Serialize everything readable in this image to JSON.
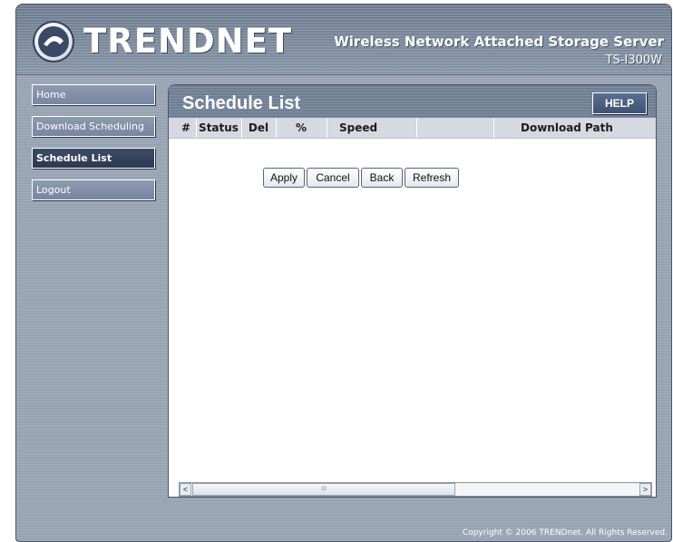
{
  "header": {
    "brand": "TRENDNET",
    "product_title": "Wireless Network Attached Storage Server",
    "model": "TS-I300W"
  },
  "sidebar": {
    "items": [
      {
        "label": "Home"
      },
      {
        "label": "Download Scheduling"
      },
      {
        "label": "Schedule List",
        "active": true
      },
      {
        "label": "Logout"
      }
    ]
  },
  "main": {
    "title": "Schedule List",
    "help_label": "HELP",
    "columns": [
      "#",
      "Status",
      "Del",
      "%",
      "Speed",
      "",
      "Download Path"
    ],
    "rows": [],
    "buttons": {
      "apply": "Apply",
      "cancel": "Cancel",
      "back": "Back",
      "refresh": "Refresh"
    },
    "scrollbar": {
      "left_arrow": "<",
      "right_arrow": ">",
      "thumb_grip": "III"
    }
  },
  "footer": {
    "copyright": "Copyright © 2006 TRENDnet. All Rights Reserved."
  },
  "colors": {
    "frame": "#97a3b3",
    "header": "#6f7e93",
    "active_nav": "#2d3850",
    "table_header": "#d5d9e1"
  }
}
